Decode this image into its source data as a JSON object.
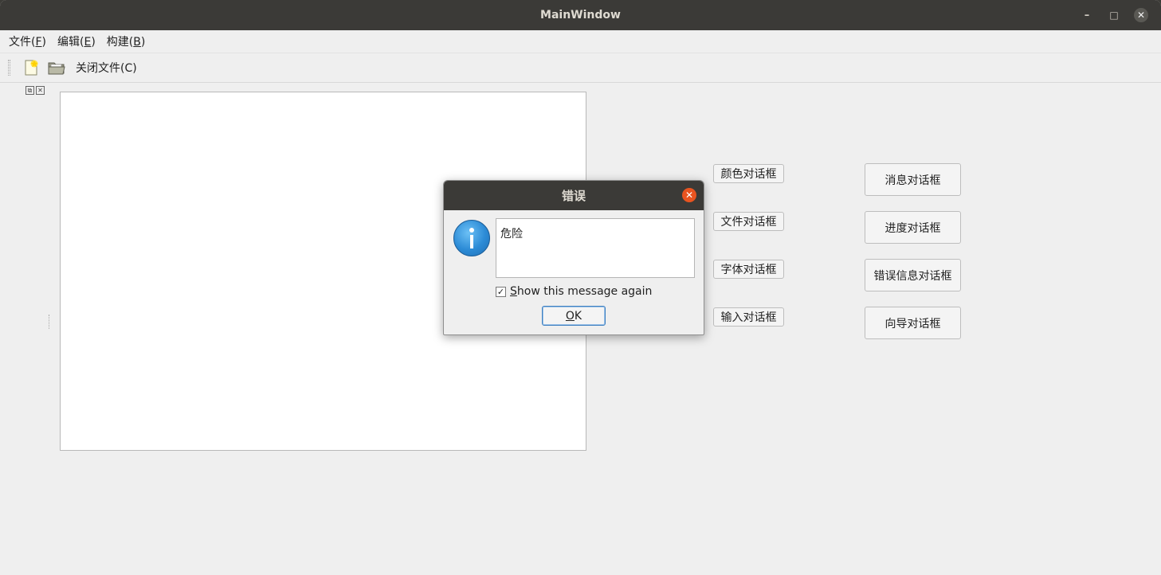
{
  "window": {
    "title": "MainWindow",
    "minimize_glyph": "–",
    "maximize_glyph": "□",
    "close_glyph": "✕"
  },
  "menubar": {
    "items": [
      {
        "label": "文件(",
        "mnemonic": "F",
        "suffix": ")"
      },
      {
        "label": "编辑(",
        "mnemonic": "E",
        "suffix": ")"
      },
      {
        "label": "构建(",
        "mnemonic": "B",
        "suffix": ")"
      }
    ]
  },
  "toolbar": {
    "new_icon": "new-file-icon",
    "open_icon": "open-folder-icon",
    "close_file_label": "关闭文件(C)"
  },
  "dock": {
    "float_glyph": "⧉",
    "close_glyph": "✕"
  },
  "buttons": {
    "color_dialog": "颜色对话框",
    "file_dialog": "文件对话框",
    "font_dialog": "字体对话框",
    "input_dialog": "输入对话框",
    "message_dialog": "消息对话框",
    "progress_dialog": "进度对话框",
    "error_dialog": "错误信息对话框",
    "wizard_dialog": "向导对话框"
  },
  "error_dialog": {
    "title": "错误",
    "close_glyph": "✕",
    "icon": "info-icon",
    "message": "危险",
    "checkbox_checked": true,
    "checkbox_mark": "✓",
    "checkbox_mnemonic": "S",
    "checkbox_rest": "how this message again",
    "ok_mnemonic": "O",
    "ok_rest": "K"
  },
  "colors": {
    "titlebar": "#3b3a37",
    "window_bg": "#efefef",
    "dialog_close": "#e95420",
    "ok_border": "#3d7fc1"
  }
}
